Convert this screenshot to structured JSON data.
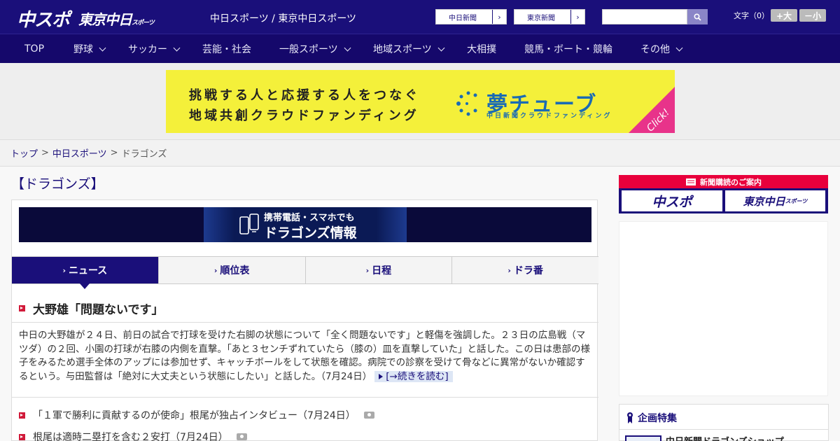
{
  "header": {
    "logo_chusupo": "中スポ",
    "logo_tokyo": "東京中日",
    "logo_tokyo_small": "スポーツ",
    "site_title": "中日スポーツ / 東京中日スポーツ",
    "links": [
      {
        "label": "中日新聞"
      },
      {
        "label": "東京新聞"
      }
    ],
    "search_placeholder": "",
    "text_size_label": "文字（0）",
    "size_up_label": "+大",
    "size_down_label": "－小"
  },
  "nav": {
    "items": [
      {
        "label": "TOP",
        "has_dropdown": false
      },
      {
        "label": "野球",
        "has_dropdown": true
      },
      {
        "label": "サッカー",
        "has_dropdown": true
      },
      {
        "label": "芸能・社会",
        "has_dropdown": false
      },
      {
        "label": "一般スポーツ",
        "has_dropdown": true
      },
      {
        "label": "地域スポーツ",
        "has_dropdown": true
      },
      {
        "label": "大相撲",
        "has_dropdown": false
      },
      {
        "label": "競馬・ボート・競輪",
        "has_dropdown": false
      },
      {
        "label": "その他",
        "has_dropdown": true
      }
    ]
  },
  "banner": {
    "line1": "挑戦する人と応援する人をつなぐ",
    "line2": "地域共創クラウドファンディング",
    "logo": "夢チューブ",
    "logo_sub": "中日新聞クラウドファンディング",
    "click": "Click!"
  },
  "breadcrumb": {
    "items": [
      "トップ",
      "中日スポーツ",
      "ドラゴンズ"
    ],
    "separator": ">"
  },
  "main": {
    "page_title": "【ドラゴンズ】",
    "mobile_banner": {
      "line1": "携帯電話・スマホでも",
      "line2": "ドラゴンズ情報"
    },
    "tabs": [
      {
        "label": "ニュース",
        "active": true
      },
      {
        "label": "順位表",
        "active": false
      },
      {
        "label": "日程",
        "active": false
      },
      {
        "label": "ドラ番",
        "active": false
      }
    ],
    "headline": "大野雄「問題ないです」",
    "article": "中日の大野雄が２４日、前日の試合で打球を受けた右脚の状態について「全く問題ないです」と軽傷を強調した。２３日の広島戦（マツダ）の２回、小園の打球が右膝の内側を直撃。「あと３センチずれていたら（膝の）皿を直撃していた」と話した。この日は患部の様子をみるため選手全体のアップには参加せず、キャッチボールをして状態を確認。病院での診察を受けて骨などに異常がないか確認するという。与田監督は「絶対に大丈夫という状態にしたい」と話した。",
    "article_date": "（7月24日）",
    "read_more": "[→続きを読む]",
    "news_list": [
      {
        "title": "「１軍で勝利に貢献するのが使命」根尾が独占インタビュー（7月24日）",
        "has_photo": true
      },
      {
        "title": "根尾は適時二塁打を含む２安打（7月24日）",
        "has_photo": true
      }
    ]
  },
  "sidebar": {
    "subscribe_head": "新聞購読のご案内",
    "subscribe_buttons": [
      {
        "label": "中スポ"
      },
      {
        "label": "東京中日",
        "small": "スポーツ"
      }
    ],
    "feature_title": "企画特集",
    "feature_item": "中日新聞ドラゴンズショップ"
  },
  "colors": {
    "brand_navy": "#1a0f7a",
    "nav_navy": "#15086b",
    "accent_red": "#d11a3a",
    "banner_yellow": "#f4f03a",
    "click_pink": "#e8338a"
  }
}
